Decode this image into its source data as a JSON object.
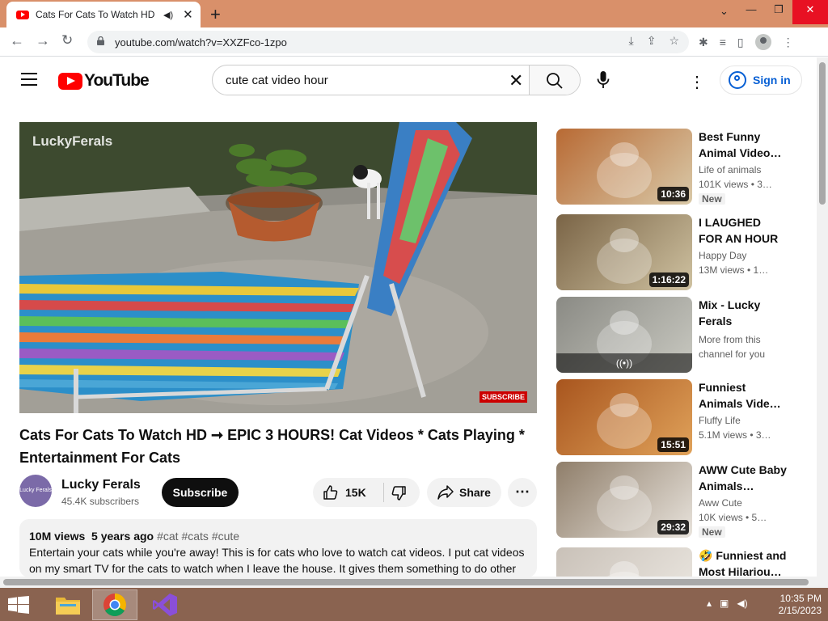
{
  "browser": {
    "tab_title": "Cats For Cats To Watch HD -",
    "url": "youtube.com/watch?v=XXZFco-1zpo"
  },
  "youtube": {
    "logo_text": "YouTube",
    "search_query": "cute cat video hour",
    "signin_label": "Sign in"
  },
  "player": {
    "watermark": "LuckyFerals",
    "subscribe_watermark": "SUBSCRIBE"
  },
  "video": {
    "title": "Cats For Cats To Watch HD ➞ EPIC 3 HOURS! Cat Videos * Cats Playing * Entertainment For Cats",
    "channel": "Lucky Ferals",
    "channel_avatar_text": "Lucky Ferals",
    "subscribers": "45.4K subscribers",
    "subscribe_label": "Subscribe",
    "likes": "15K",
    "share_label": "Share",
    "views": "10M views",
    "age": "5 years ago",
    "tags": "#cat #cats #cute",
    "description": "Entertain your cats while you're away! This is for cats who love to watch cat videos. I put cat videos on my smart TV for the cats to watch when I leave the house. It gives them something to do other"
  },
  "recommendations": [
    {
      "title": "Best Funny Animal Video…",
      "channel": "Life of animals",
      "meta": "101K views  • 3…",
      "duration": "10:36",
      "badge": "New",
      "colors": [
        "#b86a34",
        "#d9c9a8"
      ]
    },
    {
      "title": "I LAUGHED FOR AN HOUR😹…",
      "channel": "Happy Day",
      "meta": "13M views  • 1…",
      "duration": "1:16:22",
      "badge": "",
      "colors": [
        "#7a6446",
        "#cfc2a1"
      ]
    },
    {
      "title": "Mix - Lucky Ferals",
      "channel": "More from this channel for you",
      "meta": "",
      "duration": "",
      "badge": "",
      "mix_icon": "((•))",
      "colors": [
        "#8a8a84",
        "#c9c9c1"
      ]
    },
    {
      "title": "Funniest Animals Vide…",
      "channel": "Fluffy Life",
      "meta": "5.1M views  • 3…",
      "duration": "15:51",
      "badge": "",
      "colors": [
        "#a8551e",
        "#e0a25a"
      ]
    },
    {
      "title": "AWW Cute Baby Animals…",
      "channel": "Aww Cute",
      "meta": "10K views  • 5…",
      "duration": "29:32",
      "badge": "New",
      "colors": [
        "#8f7e6a",
        "#e8e3dc"
      ]
    },
    {
      "title": "🤣 Funniest and Most Hilariou…",
      "channel": "",
      "meta": "",
      "duration": "",
      "badge": "",
      "colors": [
        "#c9c1b8",
        "#eeeae4"
      ]
    }
  ],
  "taskbar": {
    "time": "10:35 PM",
    "date": "2/15/2023"
  },
  "colors": {
    "tab_strip": "#d9906a",
    "yt_red": "#ff0000",
    "link_blue": "#065fd4",
    "taskbar": "#8a6350"
  }
}
